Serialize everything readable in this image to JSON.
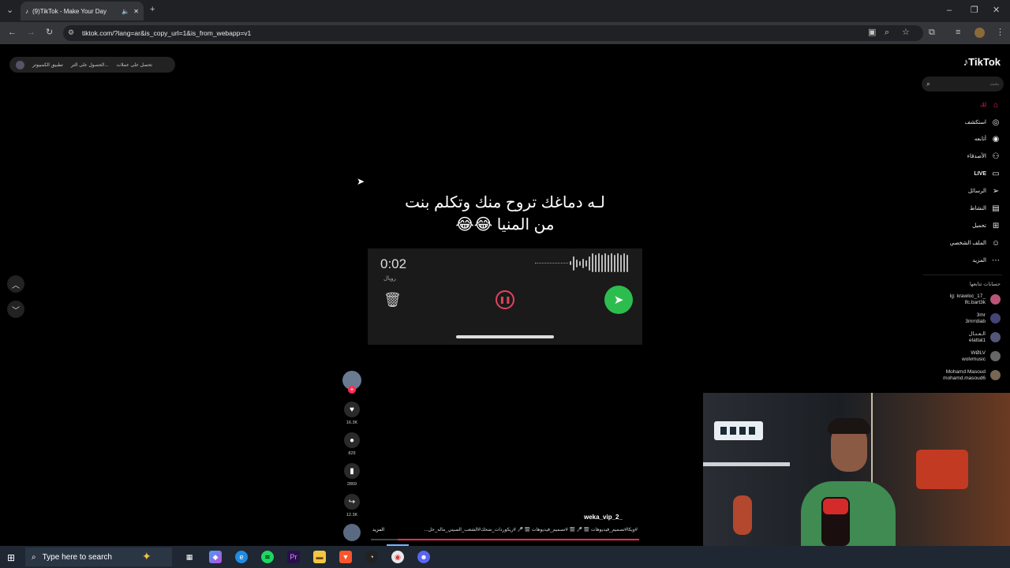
{
  "browser": {
    "tab_title": "(9)TikTok - Make Your Day",
    "url": "tiktok.com/?lang=ar&is_copy_url=1&is_from_webapp=v1"
  },
  "promo_bar": {
    "item1": "تطبيق الكمبيوتر",
    "item2": "الحصول على التر...",
    "item3": "تحصل على عملات"
  },
  "brand": "TikTok",
  "search": {
    "placeholder": "بحث"
  },
  "sidebar": {
    "items": [
      {
        "label": "لك",
        "icon": "home-icon"
      },
      {
        "label": "استكشف",
        "icon": "compass-icon"
      },
      {
        "label": "أتابعه",
        "icon": "following-icon"
      },
      {
        "label": "الأصدقاء",
        "icon": "friends-icon"
      },
      {
        "label": "LIVE",
        "icon": "live-icon"
      },
      {
        "label": "الرسائل",
        "icon": "messages-icon"
      },
      {
        "label": "النشاط",
        "icon": "activity-icon"
      },
      {
        "label": "تحميل",
        "icon": "upload-icon"
      },
      {
        "label": "الملف الشخصي",
        "icon": "profile-icon"
      },
      {
        "label": "المزيد",
        "icon": "more-icon"
      }
    ],
    "following_header": "حسابات تتابعها",
    "accounts": [
      {
        "name": "Ig: krawloc_17_",
        "handle": "lfc.bart3k"
      },
      {
        "name": "3mr",
        "handle": "3mrrdiab"
      },
      {
        "name": "الـعـتـال",
        "handle": "elattal1"
      },
      {
        "name": "WØLV",
        "handle": "wolvmusic"
      },
      {
        "name": "Mohamd Masoud",
        "handle": "mohamd.masoud6"
      }
    ]
  },
  "video": {
    "overlay_text_line1": "لـه دماغك تروح منك وتكلم بنت",
    "overlay_text_line2": "من المنيا 😂😂",
    "voice_time": "0:02",
    "voice_sub": "رويال"
  },
  "actions": {
    "likes": "16.3K",
    "comments": "829",
    "saves": "2869",
    "shares": "12.3K"
  },
  "caption": {
    "user": "weka_vip_2_",
    "tags": "#ويكا#تصميم_فيديوهات 🎬 🎤 🎬 #تصميم_فيديوهات 🎬 🎤 #ريكوردات_ضحك#الشعب_الصيني_ماله_حل...",
    "more": "المزيد"
  },
  "taskbar": {
    "search_placeholder": "Type here to search"
  }
}
